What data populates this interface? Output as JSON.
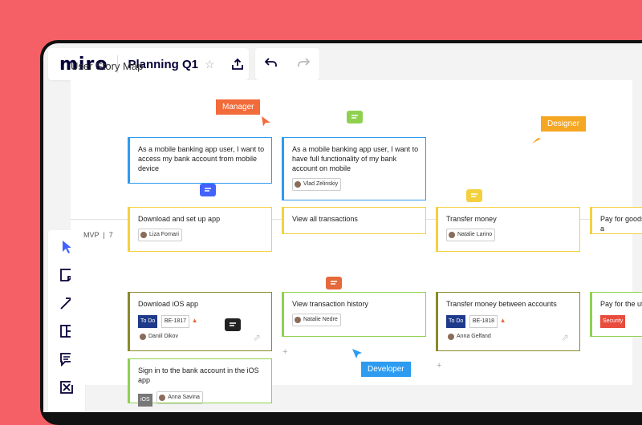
{
  "app": {
    "logo": "miro",
    "board_name": "Planning Q1",
    "star_glyph": "☆"
  },
  "board": {
    "title": "User Story Map",
    "mvp": {
      "label": "MVP",
      "count": "7"
    },
    "labels": {
      "manager": "Manager",
      "designer": "Designer",
      "developer": "Developer"
    },
    "activities": [
      {
        "text": "As a mobile banking app user, I want to access my bank account from mobile device"
      },
      {
        "text": "As a mobile banking app user, I want to have full functionality of my bank account on mobile",
        "assignee": "Vlad Zelinskiy"
      }
    ],
    "steps": [
      {
        "text": "Download and set up app",
        "assignee": "Liza Fornari"
      },
      {
        "text": "View all transactions"
      },
      {
        "text": "Transfer money",
        "assignee": "Natalie Larino"
      },
      {
        "text": "Pay for goods a"
      }
    ],
    "stories": [
      {
        "text": "Download iOS app",
        "status": "To Do",
        "ticket": "BE-1817",
        "assignee": "Daniil Dikov"
      },
      {
        "text": "View transaction history",
        "assignee": "Natalie Nedre"
      },
      {
        "text": "Transfer money between accounts",
        "status": "To Do",
        "ticket": "BE-1818",
        "assignee": "Anna Gelfand"
      },
      {
        "text": "Pay for the util",
        "tag": "Security"
      },
      {
        "text": "Sign in to the bank account in the iOS app",
        "tag": "iOS",
        "assignee": "Anna Savina"
      }
    ]
  },
  "colors": {
    "background": "#f55f66",
    "manager": "#f26b3a",
    "designer": "#f5a623",
    "developer": "#2d9bf0",
    "comment_green": "#8fd14f",
    "comment_blue": "#4262ff",
    "comment_yellow": "#f4d03f",
    "comment_orange": "#e6693c",
    "comment_dark": "#222222"
  }
}
